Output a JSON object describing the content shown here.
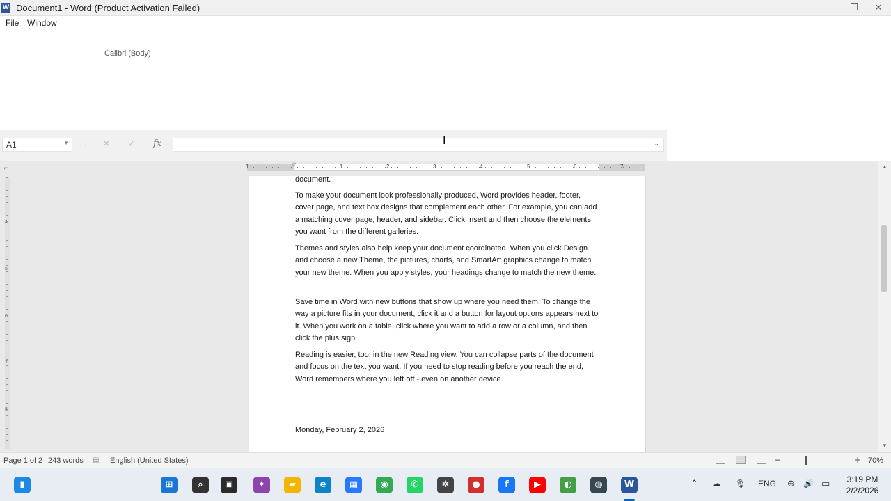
{
  "window": {
    "title": "Document1 - Word (Product Activation Failed)",
    "app_icon_letter": "W",
    "minimize_glyph": "—",
    "restore_glyph": "❐",
    "close_glyph": "✕"
  },
  "menu": {
    "items": [
      "File",
      "Window"
    ]
  },
  "ribbon": {
    "font_name": "Calibri (Body)"
  },
  "formula_bar": {
    "name_box": "A1",
    "cancel_glyph": "✕",
    "enter_glyph": "✓",
    "fx_label": "fx",
    "value": ""
  },
  "ruler": {
    "h_numbers": [
      "1",
      "1",
      "2",
      "3",
      "4",
      "5",
      "6",
      "7"
    ],
    "v_numbers": [
      "4",
      "5",
      "6",
      "7",
      "8"
    ]
  },
  "document": {
    "paragraphs": [
      "document.",
      "To make your document look professionally produced, Word provides header, footer, cover page, and text box designs that complement each other. For example, you can add a matching cover page, header, and sidebar. Click Insert and then choose the elements you want from the different galleries.",
      "Themes and styles also help keep your document coordinated. When you click Design and choose a new Theme, the pictures, charts, and SmartArt graphics change to match your new theme. When you apply styles, your headings change to match the new theme.",
      "Save time in Word with new buttons that show up where you need them. To change the way a picture fits in your document, click it and a button for layout options appears next to it. When you work on a table, click where you want to add a row or a column, and then click the plus sign.",
      "Reading is easier, too, in the new Reading view. You can collapse parts of the document and focus on the text you want. If you need to stop reading before you reach the end, Word remembers where you left off - even on another device.",
      "Monday, February 2, 2026"
    ]
  },
  "status": {
    "page": "Page 1 of 2",
    "words": "243 words",
    "language": "English (United States)",
    "zoom": "70%",
    "zoom_level": 0.31
  },
  "taskbar": {
    "apps": [
      {
        "name": "widgets",
        "glyph": "▮",
        "color": "#1e88e5"
      },
      {
        "name": "start",
        "glyph": "⊞",
        "color": "#1976d2"
      },
      {
        "name": "search",
        "glyph": "⌕",
        "color": "#333333"
      },
      {
        "name": "task-view",
        "glyph": "▣",
        "color": "#2b2b2b"
      },
      {
        "name": "copilot",
        "glyph": "✦",
        "color": "#8e44ad"
      },
      {
        "name": "file-explorer",
        "glyph": "▰",
        "color": "#f4b400"
      },
      {
        "name": "edge",
        "glyph": "e",
        "color": "#0a84c6"
      },
      {
        "name": "store",
        "glyph": "▦",
        "color": "#2979ff"
      },
      {
        "name": "chrome",
        "glyph": "◉",
        "color": "#34a853"
      },
      {
        "name": "whatsapp",
        "glyph": "✆",
        "color": "#25d366"
      },
      {
        "name": "chatgpt",
        "glyph": "✲",
        "color": "#444444"
      },
      {
        "name": "recorder",
        "glyph": "●",
        "color": "#d32f2f"
      },
      {
        "name": "facebook",
        "glyph": "f",
        "color": "#1877f2"
      },
      {
        "name": "youtube",
        "glyph": "▶",
        "color": "#ff0000"
      },
      {
        "name": "browser-green",
        "glyph": "◐",
        "color": "#43a047"
      },
      {
        "name": "camera-app",
        "glyph": "◍",
        "color": "#37474f"
      },
      {
        "name": "word",
        "glyph": "W",
        "color": "#2b579a"
      }
    ],
    "tray": {
      "chevron": "⌃",
      "cloud": "☁",
      "mic": "🎙",
      "language": "ENG",
      "network": "⊕",
      "volume": "🔊",
      "battery": "▭"
    },
    "time": "3:19 PM",
    "date": "2/2/2026"
  },
  "colors": {
    "word_blue": "#2b579a",
    "taskbar_active": "#0067c0"
  }
}
